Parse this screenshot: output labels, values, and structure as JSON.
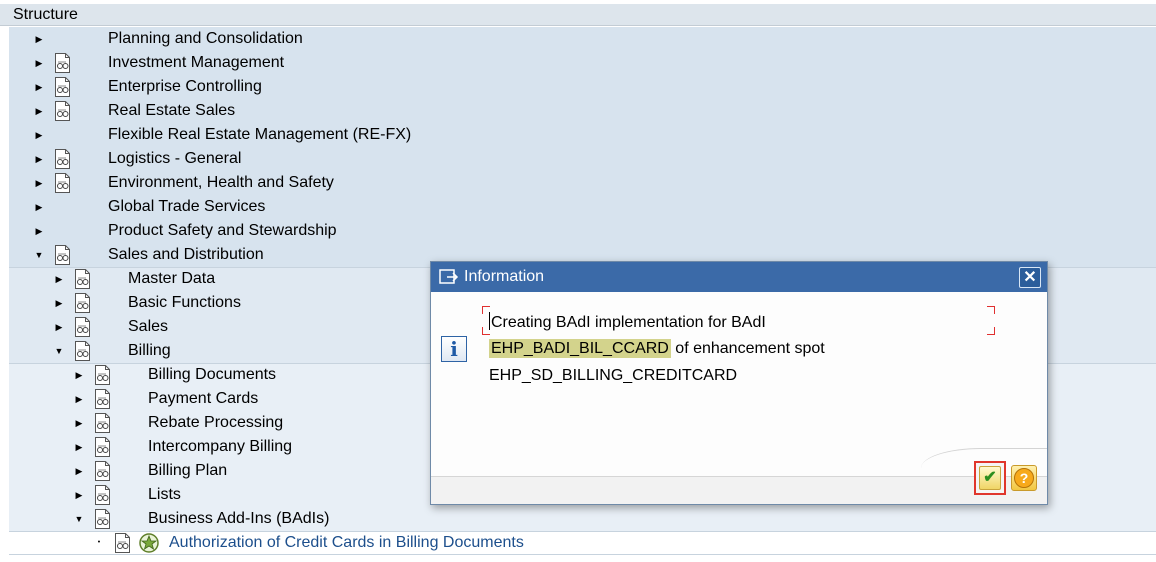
{
  "header": {
    "title": "Structure"
  },
  "tree": {
    "level1": [
      {
        "label": "Planning and Consolidation",
        "has_icon": false
      },
      {
        "label": "Investment Management",
        "has_icon": true
      },
      {
        "label": "Enterprise Controlling",
        "has_icon": true
      },
      {
        "label": "Real Estate Sales",
        "has_icon": true
      },
      {
        "label": "Flexible Real Estate Management (RE-FX)",
        "has_icon": false
      },
      {
        "label": "Logistics - General",
        "has_icon": true
      },
      {
        "label": "Environment, Health and Safety",
        "has_icon": true
      },
      {
        "label": "Global Trade Services",
        "has_icon": false
      },
      {
        "label": "Product Safety and Stewardship",
        "has_icon": false
      },
      {
        "label": "Sales and Distribution",
        "has_icon": true,
        "expanded": true
      }
    ],
    "level2": [
      {
        "label": "Master Data"
      },
      {
        "label": "Basic Functions"
      },
      {
        "label": "Sales"
      },
      {
        "label": "Billing",
        "expanded": true
      }
    ],
    "level3": [
      {
        "label": "Billing Documents"
      },
      {
        "label": "Payment Cards"
      },
      {
        "label": "Rebate Processing"
      },
      {
        "label": "Intercompany Billing"
      },
      {
        "label": "Billing Plan"
      },
      {
        "label": "Lists"
      },
      {
        "label": "Business Add-Ins (BAdIs)",
        "expanded": true
      }
    ],
    "level4": [
      {
        "label": "Authorization of Credit Cards in Billing Documents"
      }
    ]
  },
  "dialog": {
    "title": "Information",
    "line1": "Creating BAdI implementation for BAdI",
    "badi_name": "EHP_BADI_BIL_CCARD",
    "line2_rest": " of enhancement spot",
    "line3": "EHP_SD_BILLING_CREDITCARD",
    "close_glyph": "✕",
    "ok_glyph": "✔",
    "help_glyph": "?",
    "info_glyph": "i"
  },
  "colors": {
    "title_bar": "#3b6aa8",
    "highlight": "#d3d38c",
    "link_text": "#1d4f8c"
  }
}
